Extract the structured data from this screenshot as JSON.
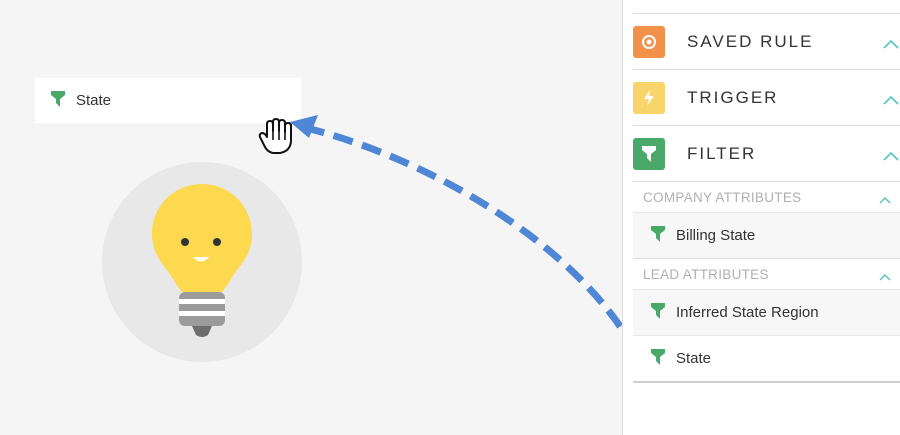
{
  "canvas": {
    "drop_chip_label": "State",
    "drop_chip_icon": "filter-icon"
  },
  "panel": {
    "sections": [
      {
        "label": "SAVED RULE",
        "icon": "saved-rule-icon",
        "color": "#f2914a"
      },
      {
        "label": "TRIGGER",
        "icon": "lightning-icon",
        "color": "#f8d46a"
      },
      {
        "label": "FILTER",
        "icon": "filter-icon",
        "color": "#4aa86a"
      }
    ],
    "company_attributes": {
      "title": "COMPANY ATTRIBUTES",
      "items": [
        "Billing State"
      ]
    },
    "lead_attributes": {
      "title": "LEAD ATTRIBUTES",
      "items": [
        "Inferred State Region",
        "State"
      ]
    }
  },
  "colors": {
    "accent": "#4fc3c3",
    "filter_green": "#4aa86a",
    "arrow_blue": "#4f86d6",
    "bulb_yellow": "#fcd94f"
  }
}
